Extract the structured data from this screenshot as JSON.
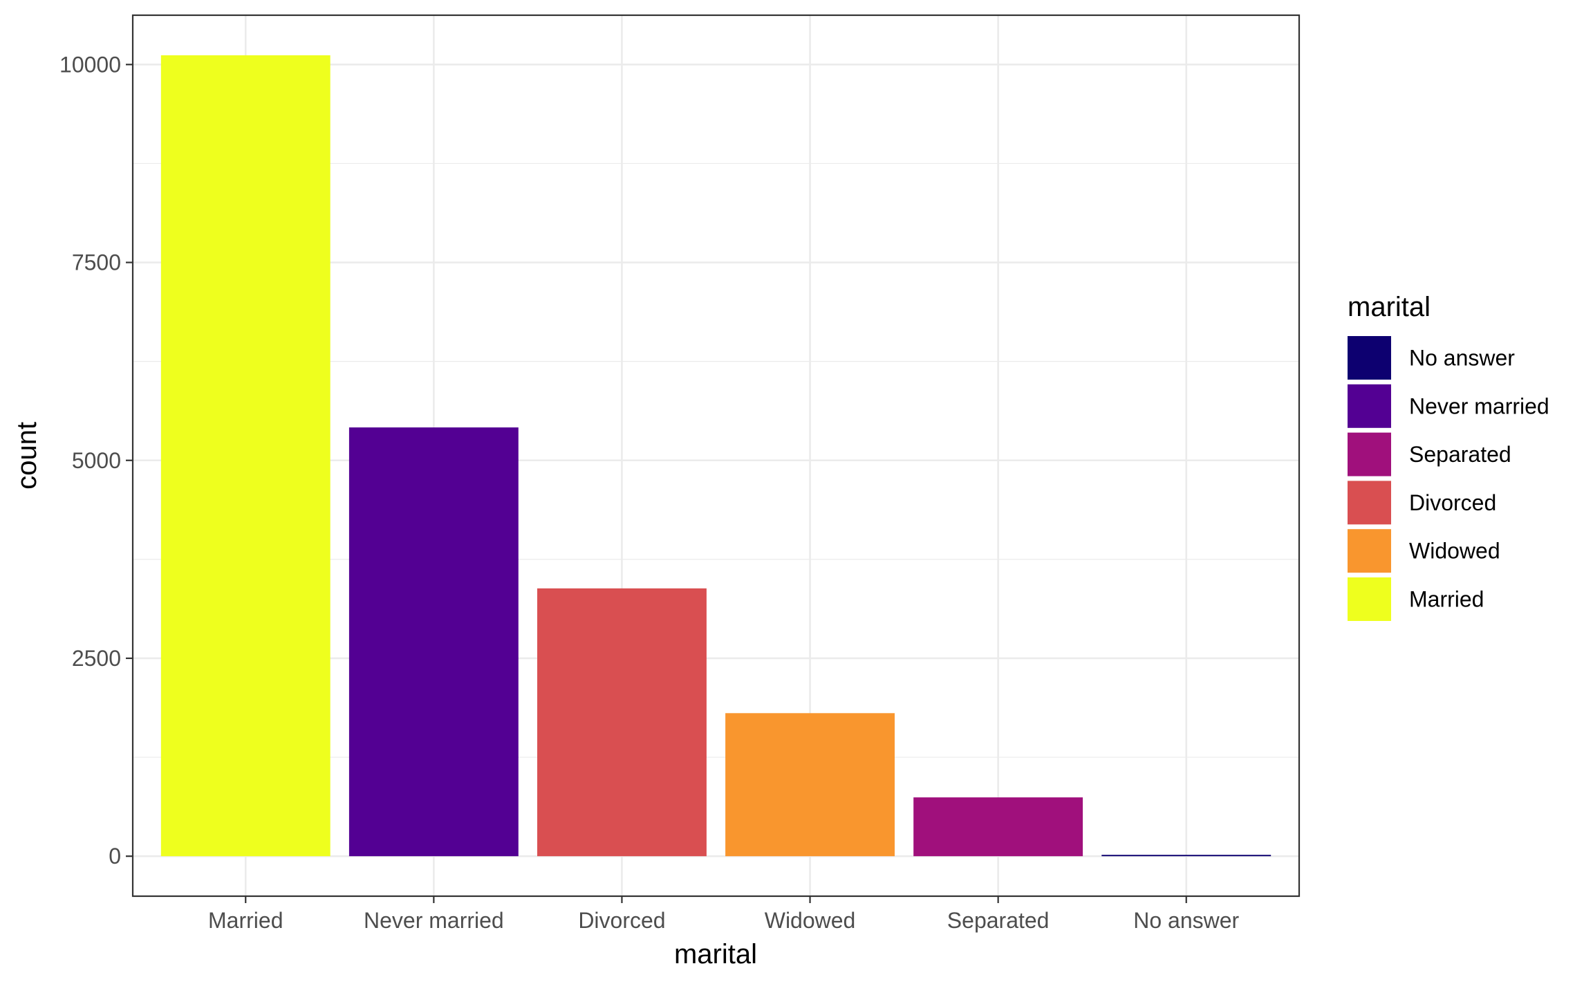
{
  "chart_data": {
    "type": "bar",
    "title": "",
    "xlabel": "marital",
    "ylabel": "count",
    "categories": [
      "Married",
      "Never married",
      "Divorced",
      "Widowed",
      "Separated",
      "No answer"
    ],
    "values": [
      10117,
      5416,
      3383,
      1807,
      743,
      17
    ],
    "bar_colors": [
      "#EEFF1E",
      "#530093",
      "#D94F51",
      "#F9962E",
      "#A0107C",
      "#0D0070"
    ],
    "ylim": [
      -505,
      10623
    ],
    "yticks": [
      0,
      2500,
      5000,
      7500,
      10000
    ],
    "ytick_labels": [
      "0",
      "2500",
      "5000",
      "7500",
      "10000"
    ],
    "grid": true,
    "theme": "bw",
    "legend": {
      "title": "marital",
      "position": "right",
      "entries": [
        {
          "label": "No answer",
          "color": "#0D0070"
        },
        {
          "label": "Never married",
          "color": "#530093"
        },
        {
          "label": "Separated",
          "color": "#A0107C"
        },
        {
          "label": "Divorced",
          "color": "#D94F51"
        },
        {
          "label": "Widowed",
          "color": "#F9962E"
        },
        {
          "label": "Married",
          "color": "#EEFF1E"
        }
      ]
    }
  }
}
